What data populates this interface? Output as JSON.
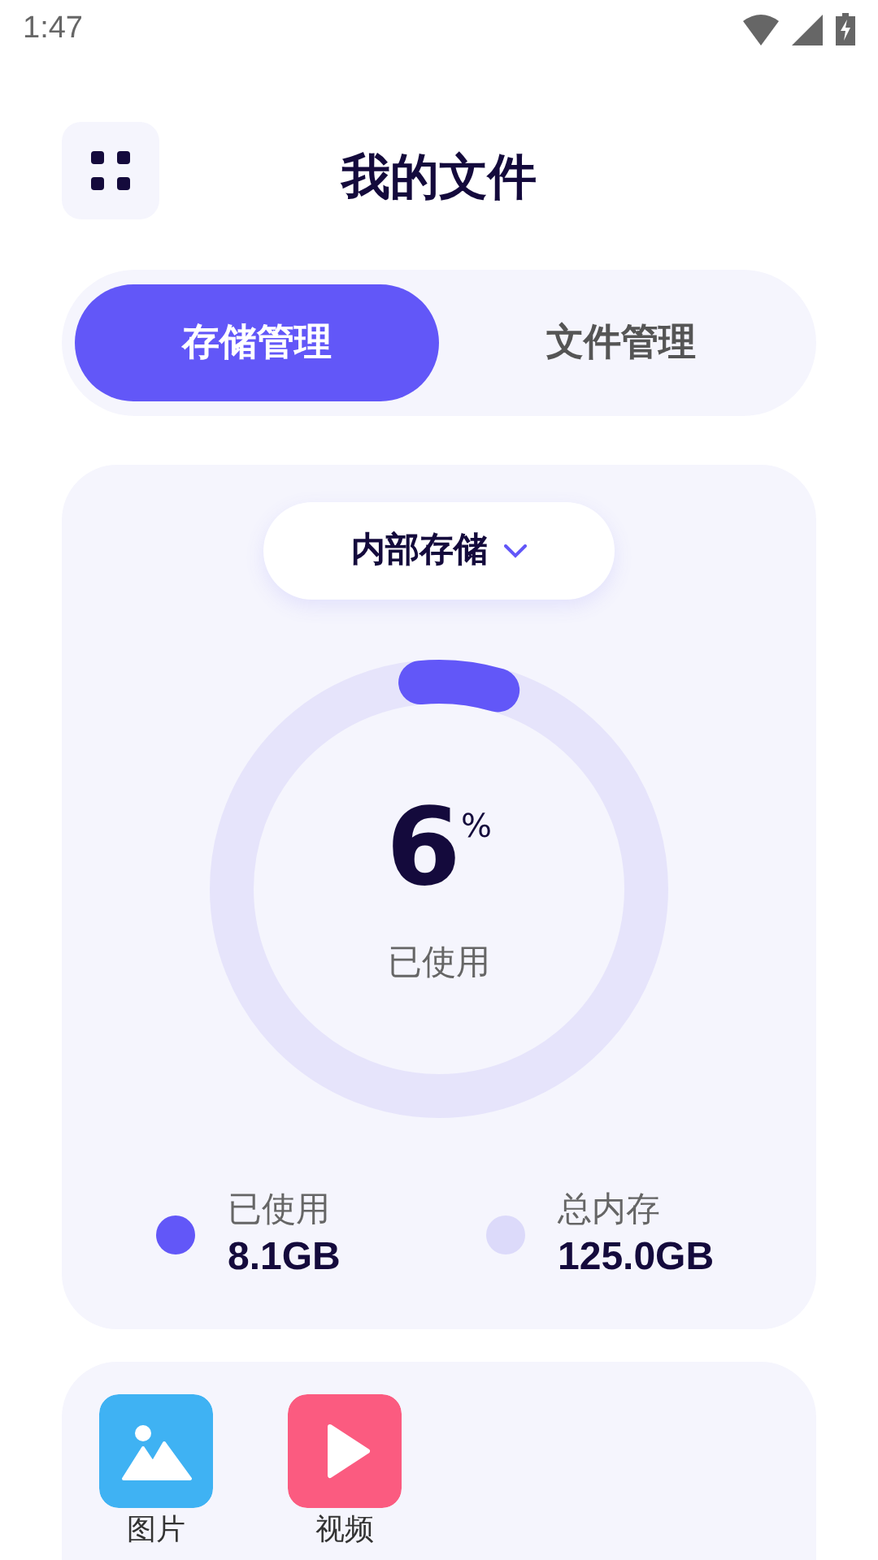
{
  "status_bar": {
    "time": "1:47"
  },
  "header": {
    "title": "我的文件"
  },
  "tabs": [
    {
      "label": "存储管理",
      "selected": true
    },
    {
      "label": "文件管理",
      "selected": false
    }
  ],
  "storage": {
    "selector": "内部存储",
    "percent": "6",
    "percent_sign": "%",
    "caption": "已使用",
    "legend": [
      {
        "label": "已使用",
        "value": "8.1GB",
        "color": "#6257f8"
      },
      {
        "label": "总内存",
        "value": "125.0GB",
        "color": "#dcdafa"
      }
    ]
  },
  "categories": [
    {
      "kind": "image",
      "label": "图片"
    },
    {
      "kind": "video",
      "label": "视频"
    }
  ]
}
